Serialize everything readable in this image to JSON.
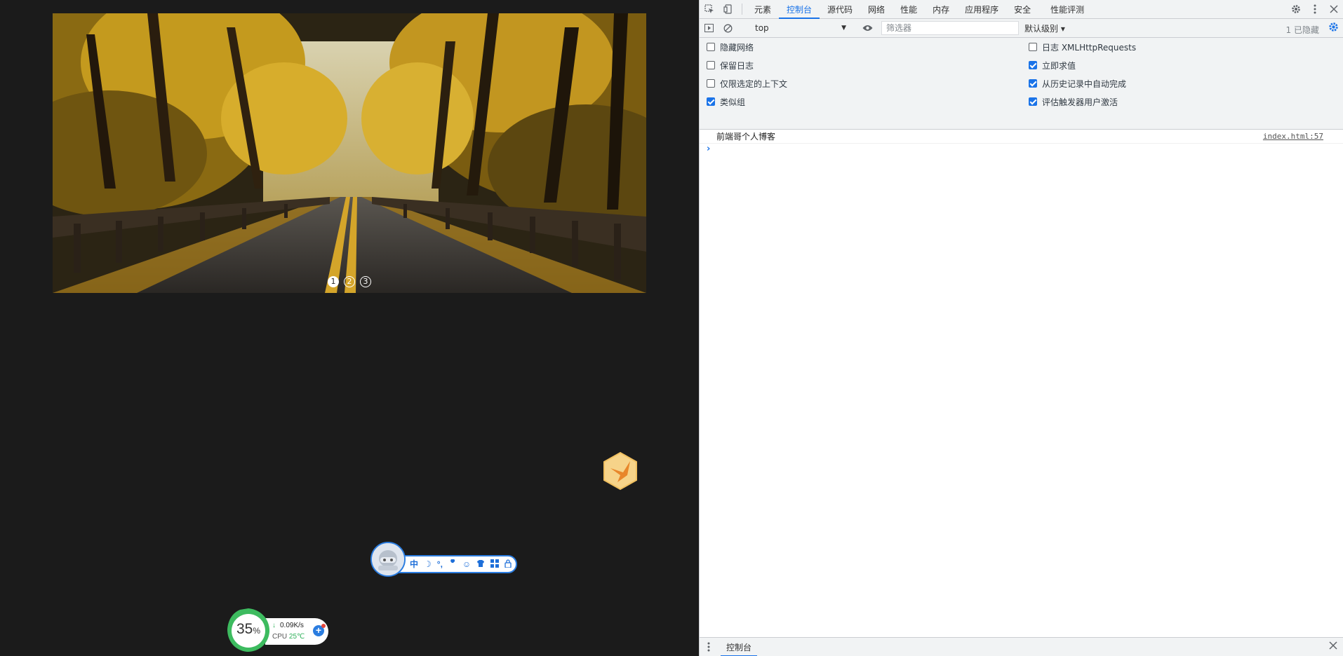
{
  "banner": {
    "slides": [
      "1",
      "2",
      "3"
    ],
    "active_slide": 1
  },
  "ime_toolbar": {
    "items": [
      "中",
      "moon-icon",
      "punctuation-icon",
      "wrench-icon",
      "emoji-icon",
      "skin-icon",
      "grid-icon",
      "lock-icon"
    ],
    "lang_label": "中"
  },
  "system_monitor": {
    "cpu_percent": 35,
    "cpu_percent_text": "35",
    "percent_sign": "%",
    "net_speed": "0.09K/s",
    "cpu_label": "CPU",
    "temperature": "25℃"
  },
  "devtools": {
    "tabs": [
      "元素",
      "控制台",
      "源代码",
      "网络",
      "性能",
      "内存",
      "应用程序",
      "安全",
      "性能评测"
    ],
    "active_tab": "控制台",
    "toolbar": {
      "context": "top",
      "filter_placeholder": "筛选器",
      "level": "默认级别 ▾",
      "hidden_count": "1 已隐藏"
    },
    "settings_left": [
      {
        "label": "隐藏网络",
        "checked": false
      },
      {
        "label": "保留日志",
        "checked": false
      },
      {
        "label": "仅限选定的上下文",
        "checked": false
      },
      {
        "label": "类似组",
        "checked": true
      }
    ],
    "settings_right": [
      {
        "label": "日志 XMLHttpRequests",
        "checked": false
      },
      {
        "label": "立即求值",
        "checked": true
      },
      {
        "label": "从历史记录中自动完成",
        "checked": true
      },
      {
        "label": "评估触发器用户激活",
        "checked": true
      }
    ],
    "console": {
      "message": "前端哥个人博客",
      "source": "index.html:57",
      "prompt": "›"
    },
    "drawer": {
      "tab": "控制台"
    },
    "colors": {
      "accent": "#1a73e8",
      "toolbar_bg": "#f1f3f4"
    }
  }
}
